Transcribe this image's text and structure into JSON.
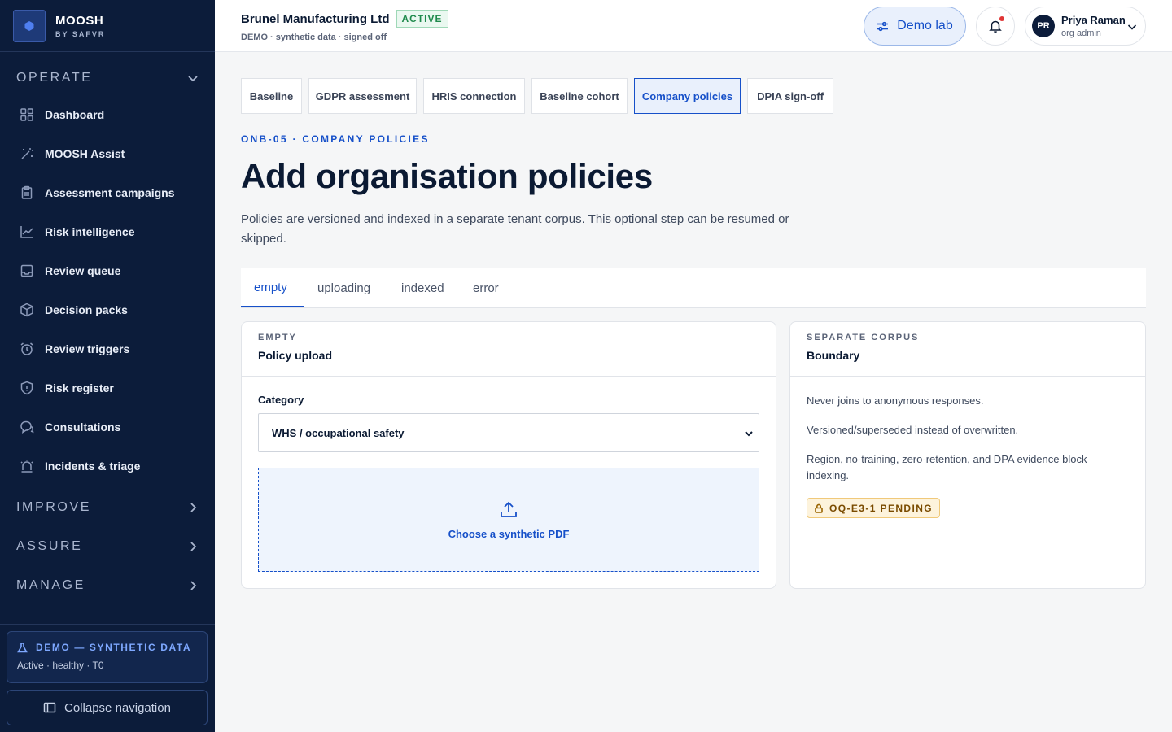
{
  "brand": {
    "name": "MOOSH",
    "sub": "BY SAFVR"
  },
  "sidebar": {
    "sections": [
      {
        "label": "OPERATE",
        "expanded": true
      },
      {
        "label": "IMPROVE",
        "expanded": false
      },
      {
        "label": "ASSURE",
        "expanded": false
      },
      {
        "label": "MANAGE",
        "expanded": false
      }
    ],
    "items": [
      {
        "label": "Dashboard",
        "icon": "grid-icon"
      },
      {
        "label": "MOOSH Assist",
        "icon": "magic-wand-icon"
      },
      {
        "label": "Assessment campaigns",
        "icon": "clipboard-icon"
      },
      {
        "label": "Risk intelligence",
        "icon": "trend-chart-icon"
      },
      {
        "label": "Review queue",
        "icon": "inbox-icon"
      },
      {
        "label": "Decision packs",
        "icon": "package-icon"
      },
      {
        "label": "Review triggers",
        "icon": "alarm-clock-icon"
      },
      {
        "label": "Risk register",
        "icon": "shield-icon"
      },
      {
        "label": "Consultations",
        "icon": "chat-bubbles-icon"
      },
      {
        "label": "Incidents & triage",
        "icon": "siren-icon"
      }
    ],
    "demo": {
      "title": "DEMO — SYNTHETIC DATA",
      "status": "Active · healthy · T0"
    },
    "collapse_label": "Collapse navigation"
  },
  "header": {
    "org_name": "Brunel Manufacturing Ltd",
    "org_status": "ACTIVE",
    "org_sub": "DEMO · synthetic data · signed off",
    "demo_lab": "Demo lab",
    "user": {
      "initials": "PR",
      "name": "Priya Raman",
      "role": "org admin"
    }
  },
  "steps": [
    "Baseline",
    "GDPR assessment",
    "HRIS connection",
    "Baseline cohort",
    "Company policies",
    "DPIA sign-off"
  ],
  "active_step": "Company policies",
  "page": {
    "eyebrow": "ONB-05 · COMPANY POLICIES",
    "title": "Add organisation policies",
    "description": "Policies are versioned and indexed in a separate tenant corpus. This optional step can be resumed or skipped."
  },
  "state_tabs": [
    "empty",
    "uploading",
    "indexed",
    "error"
  ],
  "active_state_tab": "empty",
  "upload_card": {
    "kicker": "EMPTY",
    "title": "Policy upload",
    "category_label": "Category",
    "category_value": "WHS / occupational safety",
    "dropzone_label": "Choose a synthetic PDF"
  },
  "boundary_card": {
    "kicker": "SEPARATE CORPUS",
    "title": "Boundary",
    "lines": [
      "Never joins to anonymous responses.",
      "Versioned/superseded instead of overwritten.",
      "Region, no-training, zero-retention, and DPA evidence block indexing."
    ],
    "badge": "OQ-E3-1 PENDING"
  },
  "colors": {
    "sidebar": "#0c1c3a",
    "accent": "#1650c9",
    "active_green": "#1f8a4c",
    "pending": "#7a4b00"
  }
}
